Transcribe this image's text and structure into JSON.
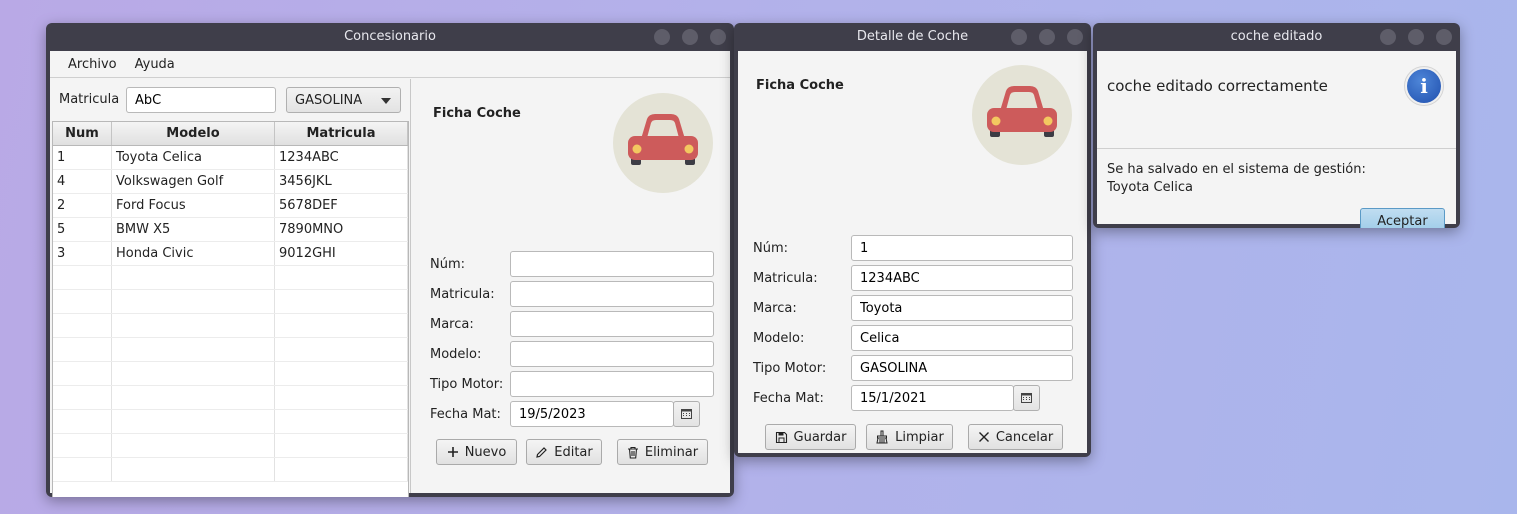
{
  "main_window": {
    "title": "Concesionario",
    "menu": [
      "Archivo",
      "Ayuda"
    ],
    "filter": {
      "label": "Matricula",
      "value": "AbC",
      "motor_select": "GASOLINA"
    },
    "table": {
      "columns": [
        "Num",
        "Modelo",
        "Matricula"
      ],
      "rows": [
        [
          "1",
          "Toyota Celica",
          "1234ABC"
        ],
        [
          "4",
          "Volkswagen Golf",
          "3456JKL"
        ],
        [
          "2",
          "Ford Focus",
          "5678DEF"
        ],
        [
          "5",
          "BMW X5",
          "7890MNO"
        ],
        [
          "3",
          "Honda Civic",
          "9012GHI"
        ]
      ]
    },
    "form": {
      "title": "Ficha Coche",
      "num_label": "Núm:",
      "num_value": "",
      "matricula_label": "Matricula:",
      "matricula_value": "",
      "marca_label": "Marca:",
      "marca_value": "",
      "modelo_label": "Modelo:",
      "modelo_value": "",
      "motor_label": "Tipo Motor:",
      "motor_value": "",
      "fecha_label": "Fecha Mat:",
      "fecha_value": "19/5/2023",
      "nuevo_label": "Nuevo",
      "editar_label": "Editar",
      "eliminar_label": "Eliminar"
    }
  },
  "detail_window": {
    "title": "Detalle de Coche",
    "form": {
      "title": "Ficha Coche",
      "num_label": "Núm:",
      "num_value": "1",
      "matricula_label": "Matricula:",
      "matricula_value": "1234ABC",
      "marca_label": "Marca:",
      "marca_value": "Toyota",
      "modelo_label": "Modelo:",
      "modelo_value": "Celica",
      "motor_label": "Tipo Motor:",
      "motor_value": "GASOLINA",
      "fecha_label": "Fecha Mat:",
      "fecha_value": "15/1/2021",
      "guardar_label": "Guardar",
      "limpiar_label": "Limpiar",
      "cancelar_label": "Cancelar"
    }
  },
  "dialog": {
    "title": "coche editado",
    "header": "coche editado correctamente",
    "message_line1": "Se ha salvado en el sistema de gestión:",
    "message_line2": "Toyota Celica",
    "accept_label": "Aceptar",
    "icon_glyph": "i"
  },
  "colors": {
    "car_body": "#cd5b5b",
    "avatar_bg": "#e4e3d6",
    "titlebar": "#3f3e4a",
    "info_blue": "#2b5fb8"
  }
}
